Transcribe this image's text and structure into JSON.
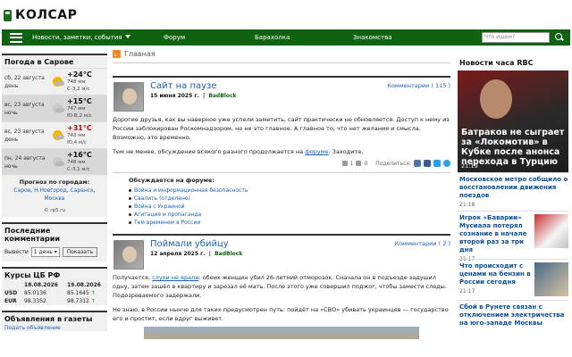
{
  "site": {
    "logo_text": "КОЛСАР"
  },
  "nav": {
    "items": [
      "Новости, заметки, события",
      "Форум",
      "Барахолка",
      "Знакомства"
    ],
    "search_placeholder": "Что ищем?"
  },
  "weather": {
    "title": "Погода в Сарове",
    "rows": [
      {
        "date": "сб, 22 августа",
        "part": "день",
        "temp": "+24°C",
        "p": "748 мм",
        "w": "С-З,2 м/с"
      },
      {
        "date": "вс, 23 августа",
        "part": "ночь",
        "temp": "+15°C",
        "p": "747 мм",
        "w": "Ю-В,2 м/с"
      },
      {
        "date": "вс, 23 августа",
        "part": "день",
        "temp": "+31°C",
        "p": "743 мм",
        "w": "Ю,4 м/с"
      },
      {
        "date": "пн, 24 августа",
        "part": "ночь",
        "temp": "+16°C",
        "p": "748 мм",
        "w": "С-З,1 м/с"
      }
    ],
    "forecast_title": "Прогноз по городам:",
    "forecast_links": [
      "Саров",
      "Н.Новгород",
      "Саранск",
      "Москва"
    ],
    "source": "© rp5.ru"
  },
  "comments": {
    "title": "Последние комментарии",
    "show_label": "Вывести",
    "period": "1 день",
    "button": "Показать"
  },
  "rates": {
    "title": "Курсы ЦБ РФ",
    "dates": [
      "18.08.2026",
      "19.08.2026"
    ],
    "rows": [
      {
        "code": "USD",
        "a": "85.0136",
        "b": "85.1645",
        "dir": "↑"
      },
      {
        "code": "EUR",
        "a": "98.3352",
        "b": "98.7312",
        "dir": "↑"
      }
    ]
  },
  "ads": {
    "title": "Объявления в газеты",
    "link": "Подать объявление"
  },
  "breadcrumb": "Главная",
  "posts": [
    {
      "title": "Сайт на паузе",
      "date": "15 июня 2025 г.",
      "author": "BadBlock",
      "comments": "Комментарии ( 115 )",
      "p1": "Дорогие друзья, как вы наверное уже успели заметить, сайт практически не обновляется. Доступ к нему из России заблокирован Роскомнадзором, но не это главное. А главное то, что нет желания и смысла. Возможно, это временно.",
      "p2a": "Тем не менее, обсуждение всякого разного продолжается на ",
      "p2link": "форуме",
      "p2b": ". Заходите.",
      "likes": "1",
      "dislikes": "0",
      "share": "Поделиться:",
      "forum_title": "Обсуждается на форуме:",
      "forum_items": [
        "Война и информационная безопасность",
        "Свалить (отделено)",
        "Война с Украиной",
        "Агитация и пропаганда",
        "Тем временем в России"
      ]
    },
    {
      "title": "Поймали убийцу",
      "date": "12 апреля 2025 г.",
      "author": "BadBlock",
      "comments": "Комментарии ( 2 )",
      "p1a": "Получается, ",
      "p1link": "слухи не врали",
      "p1b": ": обеих женщин убил 26-летний отморозок. Сначала он в подъезде задушил одну, затем зашёл в квартиру и зарезал её мать. После этого уже совершил поджог, чтобы замести следы. Подозреваемого задержали.",
      "p2": "Не знаю, в России нынче для таких предусмотрен путь: пойдёт на «СВО» убивать украинцев — государство его и простит, если вдруг выживет."
    }
  ],
  "news": {
    "title": "Новости часа RBC",
    "lead": {
      "title": "Батраков не сыграет за «Локомотив» в Кубке после анонса перехода в Турцию",
      "time": "21:19"
    },
    "items": [
      {
        "title": "Московское метро собщило о восстановлении движения поездов",
        "time": "21:18"
      },
      {
        "title": "Игрок «Баварии» Мусиала потерял сознание в начале второй раз за три дня",
        "time": "21:17"
      },
      {
        "title": "Что происходит с ценами на бензин в России сегодня",
        "time": "21:17"
      },
      {
        "title": "Сбой в Рунете связан с отключением электричества на юго-западе Москвы",
        "time": ""
      }
    ]
  },
  "colors": {
    "brand_green": "#0f620f",
    "link_blue": "#1a5fb4",
    "hot_red": "#cc0000"
  }
}
